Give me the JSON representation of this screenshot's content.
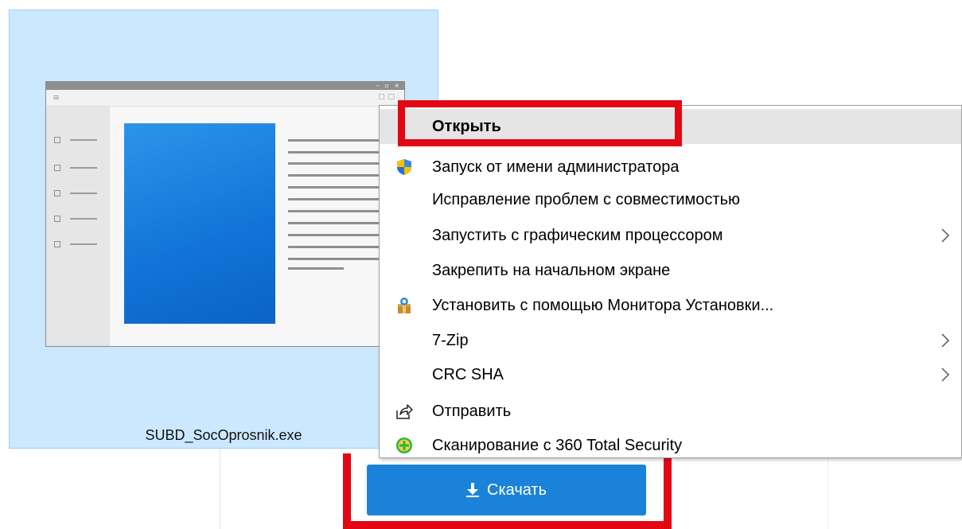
{
  "file": {
    "name": "SUBD_SocOprosnik.exe",
    "selection_color": "#cce8ff"
  },
  "context_menu": {
    "items": [
      {
        "label": "Открыть",
        "icon": null,
        "submenu": false,
        "bold": true,
        "hover": true
      },
      {
        "label": "Запуск от имени администратора",
        "icon": "uac-shield-icon",
        "submenu": false
      },
      {
        "label": "Исправление проблем с совместимостью",
        "icon": null,
        "submenu": false
      },
      {
        "label": "Запустить с графическим процессором",
        "icon": null,
        "submenu": true
      },
      {
        "label": "Закрепить на начальном экране",
        "icon": null,
        "submenu": false
      },
      {
        "label": "Установить с помощью Монитора Установки...",
        "icon": "install-monitor-icon",
        "submenu": false
      },
      {
        "label": "7-Zip",
        "icon": null,
        "submenu": true
      },
      {
        "label": "CRC SHA",
        "icon": null,
        "submenu": true
      },
      {
        "label": "Отправить",
        "icon": "share-icon",
        "submenu": false
      },
      {
        "label": "Сканирование с 360 Total Security",
        "icon": "360-security-icon",
        "submenu": false
      }
    ]
  },
  "download": {
    "label": "Скачать",
    "icon": "download-icon",
    "color": "#1a83d9"
  },
  "highlight_color": "#e30613"
}
